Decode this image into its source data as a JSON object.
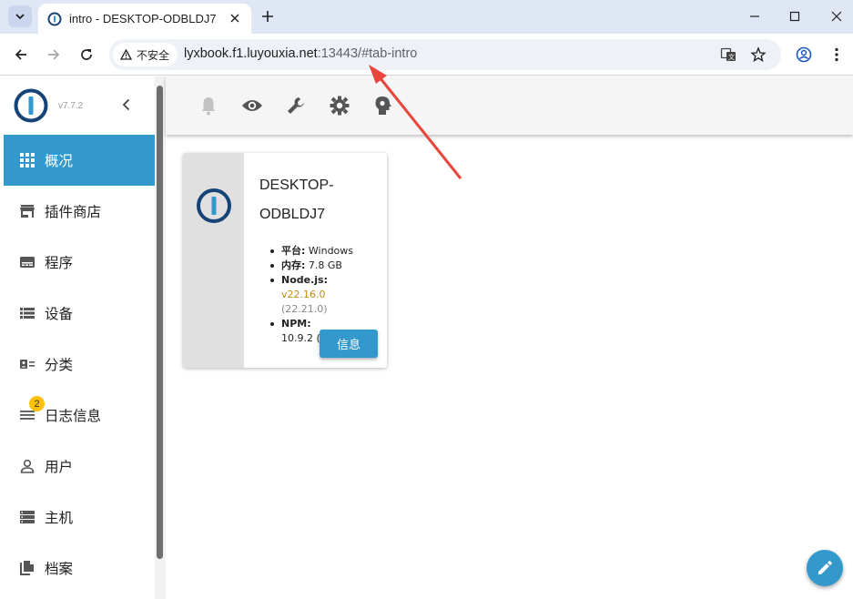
{
  "browser": {
    "tab_title": "intro - DESKTOP-ODBLDJ7",
    "security_label": "不安全",
    "url_host": "lyxbook.f1.luyouxia.net",
    "url_rest": ":13443/#tab-intro"
  },
  "app": {
    "version": "v7.7.2",
    "sidebar": {
      "items": [
        {
          "label": "概况",
          "icon": "grid-icon",
          "active": true
        },
        {
          "label": "插件商店",
          "icon": "store-icon"
        },
        {
          "label": "程序",
          "icon": "instances-icon"
        },
        {
          "label": "设备",
          "icon": "list-icon"
        },
        {
          "label": "分类",
          "icon": "enum-icon"
        },
        {
          "label": "日志信息",
          "icon": "log-icon",
          "badge": "2"
        },
        {
          "label": "用户",
          "icon": "user-icon"
        },
        {
          "label": "主机",
          "icon": "hosts-icon"
        },
        {
          "label": "档案",
          "icon": "files-icon"
        }
      ]
    },
    "toolbar_icons": [
      "bell-icon",
      "eye-icon",
      "wrench-icon",
      "gear-icon",
      "expert-head-icon"
    ],
    "card": {
      "title": "DESKTOP-ODBLDJ7",
      "platform_label": "平台:",
      "platform_value": "Windows",
      "memory_label": "内存:",
      "memory_value": "7.8 GB",
      "node_label": "Node.js:",
      "node_value": "v22.16.0",
      "node_latest": "(22.21.0)",
      "npm_label": "NPM:",
      "npm_value": "10.9.2 (10.9.4)",
      "info_button": "信息"
    },
    "colors": {
      "accent": "#3399cc",
      "badge": "#ffc107",
      "arrow": "#e8453c"
    }
  }
}
